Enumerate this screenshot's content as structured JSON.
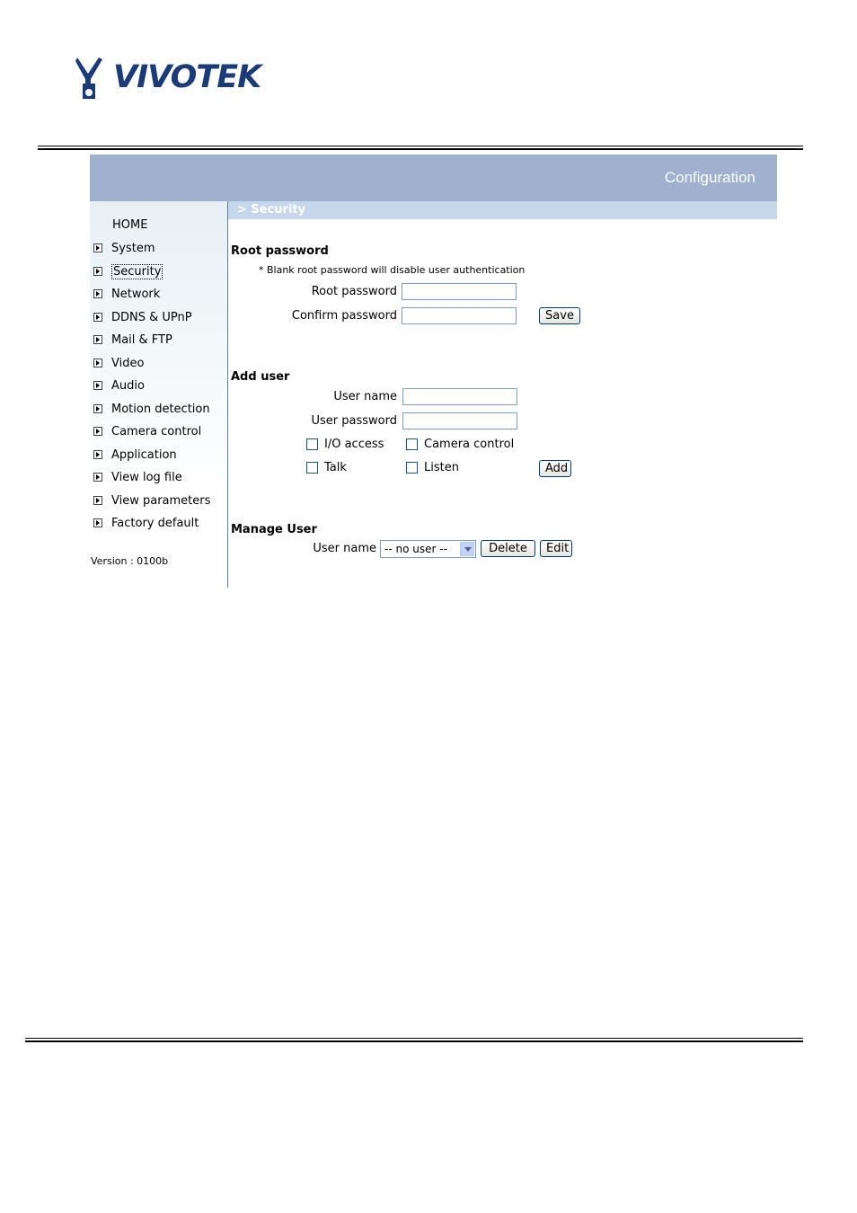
{
  "logo": {
    "text": "VIVOTEK"
  },
  "banner": {
    "title": "Configuration"
  },
  "breadcrumb": "> Security",
  "sidebar": {
    "home": "HOME",
    "items": [
      {
        "label": "System"
      },
      {
        "label": "Security"
      },
      {
        "label": "Network"
      },
      {
        "label": "DDNS & UPnP"
      },
      {
        "label": "Mail & FTP"
      },
      {
        "label": "Video"
      },
      {
        "label": "Audio"
      },
      {
        "label": "Motion detection"
      },
      {
        "label": "Camera control"
      },
      {
        "label": "Application"
      },
      {
        "label": "View log file"
      },
      {
        "label": "View parameters"
      },
      {
        "label": "Factory default"
      }
    ],
    "version": "Version : 0100b"
  },
  "root_password": {
    "heading": "Root password",
    "note": "* Blank root password will disable user authentication",
    "root_label": "Root password",
    "confirm_label": "Confirm password",
    "root_value": "",
    "confirm_value": "",
    "save_label": "Save"
  },
  "add_user": {
    "heading": "Add user",
    "username_label": "User name",
    "password_label": "User password",
    "username_value": "",
    "password_value": "",
    "io_access": "I/O access",
    "camera_control": "Camera control",
    "talk": "Talk",
    "listen": "Listen",
    "add_label": "Add"
  },
  "manage_user": {
    "heading": "Manage User",
    "username_label": "User name",
    "selected_user": "-- no user --",
    "delete_label": "Delete",
    "edit_label": "Edit"
  }
}
